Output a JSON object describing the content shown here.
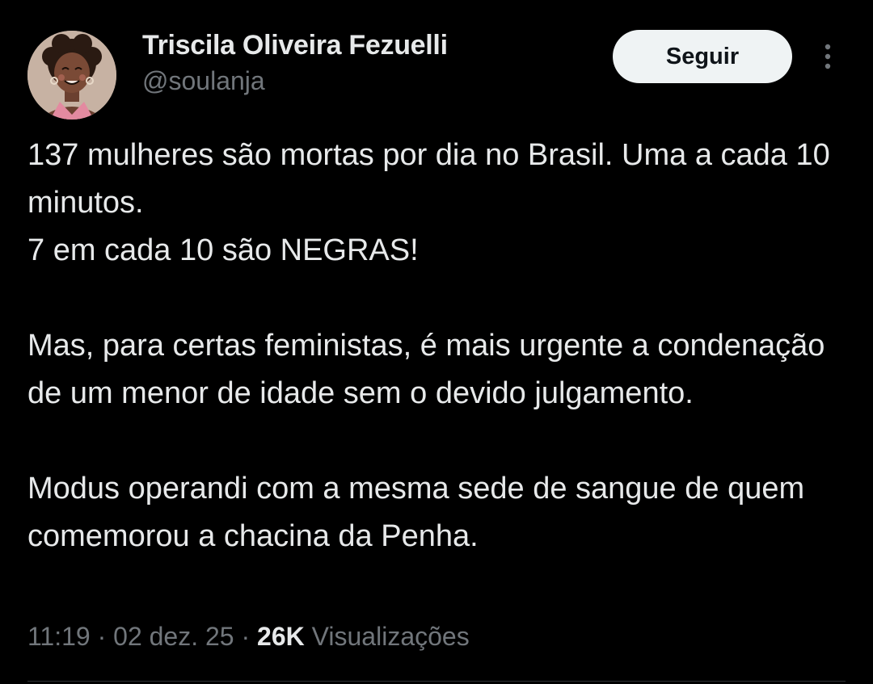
{
  "author": {
    "name": "Triscila Oliveira Fezuelli",
    "handle": "@soulanja",
    "avatar_icon": "cartoon-woman-avatar-icon"
  },
  "actions": {
    "follow_label": "Seguir",
    "more_icon": "more-vertical-icon"
  },
  "tweet": {
    "paragraphs": [
      "137 mulheres são mortas por dia no Brasil. Uma a cada 10 minutos.\n7 em cada 10 são NEGRAS!",
      "Mas, para certas feministas, é mais urgente a condenação de um menor de idade sem o devido julgamento.",
      "Modus operandi com a mesma sede de sangue de quem comemorou a chacina da Penha."
    ]
  },
  "meta": {
    "time": "11:19",
    "separator": " · ",
    "date": "02 dez. 25",
    "views_count": "26K",
    "views_label": "Visualizações"
  },
  "colors": {
    "background": "#000000",
    "text_primary": "#e7e9ea",
    "text_secondary": "#71767b",
    "button_bg": "#eff3f4",
    "button_text": "#0f1419"
  }
}
